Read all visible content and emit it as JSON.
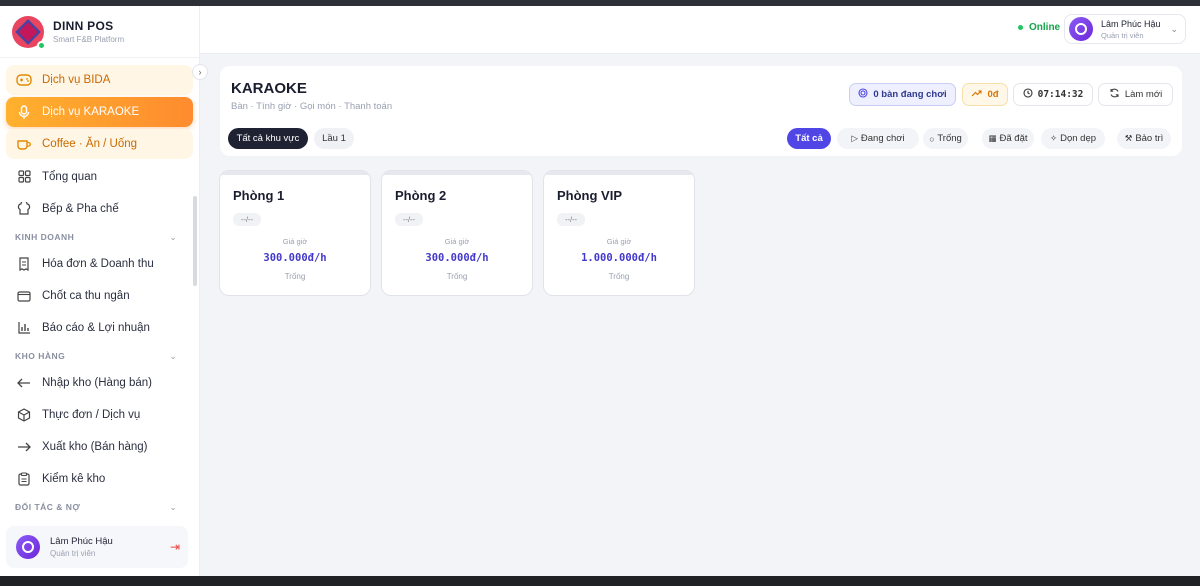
{
  "brand": {
    "title": "DINN POS",
    "subtitle": "Smart F&B Platform"
  },
  "sidebar": {
    "services": [
      {
        "label": "Dịch vụ BIDA",
        "icon": "gamepad-icon"
      },
      {
        "label": "Dịch vụ KARAOKE",
        "icon": "microphone-icon"
      },
      {
        "label": "Coffee · Ăn / Uống",
        "icon": "coffee-icon"
      }
    ],
    "general": [
      {
        "label": "Tổng quan",
        "icon": "grid-icon"
      },
      {
        "label": "Bếp & Pha chế",
        "icon": "chef-hat-icon"
      }
    ],
    "sections": [
      {
        "title": "KINH DOANH",
        "items": [
          "Hóa đơn & Doanh thu",
          "Chốt ca thu ngân",
          "Báo cáo & Lợi nhuận"
        ]
      },
      {
        "title": "KHO HÀNG",
        "items": [
          "Nhập kho (Hàng bán)",
          "Thực đơn / Dịch vụ",
          "Xuất kho (Bán hàng)",
          "Kiểm kê kho"
        ]
      },
      {
        "title": "ĐỐI TÁC & NỢ",
        "items": []
      }
    ],
    "user": {
      "name": "Lâm Phúc Hậu",
      "role": "Quản trị viên"
    }
  },
  "header": {
    "status": "Online",
    "user": {
      "name": "Lâm Phúc Hậu",
      "role": "Quản trị viên"
    }
  },
  "main": {
    "title": "KARAOKE",
    "subtitle": "Bàn · Tính giờ · Gọi món · Thanh toán",
    "playing_label": "0 bàn đang chơi",
    "revenue": "0đ",
    "clock": "07:14:32",
    "refresh_label": "Làm mới",
    "areas": [
      "Tất cả khu vực",
      "Lầu 1"
    ],
    "status_filters": [
      {
        "label": "Tất cả",
        "icon": ""
      },
      {
        "label": "Đang chơi",
        "icon": "▷"
      },
      {
        "label": "Trống",
        "icon": "○"
      },
      {
        "label": "Đã đặt",
        "icon": "▦"
      },
      {
        "label": "Dọn dẹp",
        "icon": "✧"
      },
      {
        "label": "Bảo trì",
        "icon": "⚒"
      }
    ],
    "rooms": [
      {
        "name": "Phòng 1",
        "time": "--/--",
        "price_label": "Giá giờ",
        "price": "300.000đ/h",
        "status": "Trống"
      },
      {
        "name": "Phòng 2",
        "time": "--/--",
        "price_label": "Giá giờ",
        "price": "300.000đ/h",
        "status": "Trống"
      },
      {
        "name": "Phòng VIP",
        "time": "--/--",
        "price_label": "Giá giờ",
        "price": "1.000.000đ/h",
        "status": "Trống"
      }
    ]
  }
}
